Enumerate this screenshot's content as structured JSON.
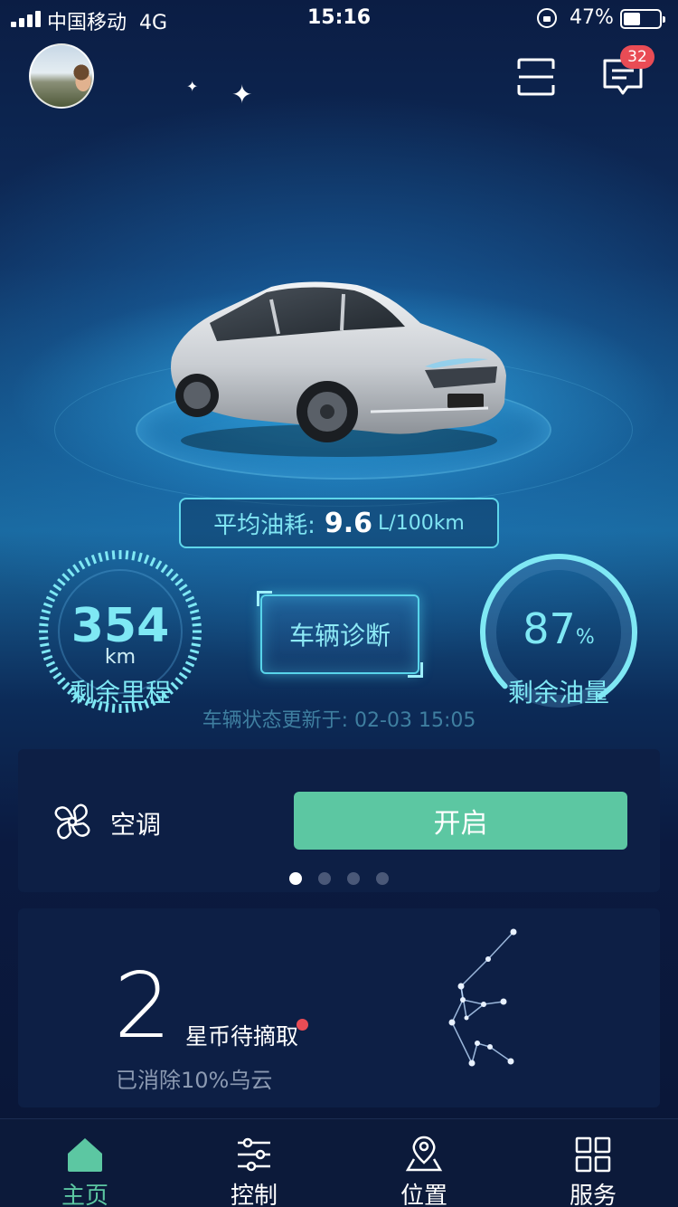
{
  "status_bar": {
    "carrier": "中国移动",
    "network": "4G",
    "time": "15:16",
    "battery_text": "47%",
    "battery_level": 0.47
  },
  "header": {
    "notification_count": "32",
    "icons": [
      "avatar",
      "scan-icon",
      "message-icon"
    ]
  },
  "car": {
    "avg_fuel_label": "平均油耗:",
    "avg_fuel_value": "9.6",
    "avg_fuel_unit": "L/100km",
    "mileage_value": "354",
    "mileage_unit": "km",
    "mileage_label": "剩余里程",
    "oil_value": "87",
    "oil_unit": "%",
    "oil_label": "剩余油量",
    "oil_level": 0.87,
    "diagnose_label": "车辆诊断",
    "update_text": "车辆状态更新于: 02-03 15:05"
  },
  "ac_card": {
    "label": "空调",
    "button_label": "开启",
    "pages": 4,
    "active_page": 0
  },
  "coin_card": {
    "count": "2",
    "title": "星币待摘取",
    "subtitle": "已消除10%乌云"
  },
  "tabs": [
    {
      "label": "主页",
      "icon": "home-icon",
      "active": true
    },
    {
      "label": "控制",
      "icon": "sliders-icon",
      "active": false
    },
    {
      "label": "位置",
      "icon": "location-icon",
      "active": false
    },
    {
      "label": "服务",
      "icon": "grid-icon",
      "active": false
    }
  ],
  "colors": {
    "accent_green": "#5cc7a2",
    "accent_cyan": "#7fe8f4",
    "badge_red": "#e94c55",
    "card_bg": "#0d1f45"
  }
}
